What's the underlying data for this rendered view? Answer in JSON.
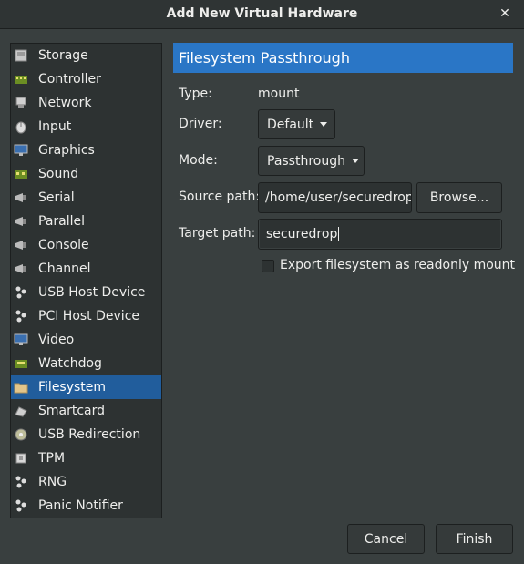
{
  "window": {
    "title": "Add New Virtual Hardware",
    "close_glyph": "✕"
  },
  "sidebar": {
    "items": [
      {
        "label": "Storage",
        "icon": "storage-icon"
      },
      {
        "label": "Controller",
        "icon": "controller-icon"
      },
      {
        "label": "Network",
        "icon": "network-icon"
      },
      {
        "label": "Input",
        "icon": "mouse-icon"
      },
      {
        "label": "Graphics",
        "icon": "monitor-icon"
      },
      {
        "label": "Sound",
        "icon": "sound-card-icon"
      },
      {
        "label": "Serial",
        "icon": "serial-port-icon"
      },
      {
        "label": "Parallel",
        "icon": "parallel-port-icon"
      },
      {
        "label": "Console",
        "icon": "console-port-icon"
      },
      {
        "label": "Channel",
        "icon": "channel-port-icon"
      },
      {
        "label": "USB Host Device",
        "icon": "usb-icon"
      },
      {
        "label": "PCI Host Device",
        "icon": "pci-icon"
      },
      {
        "label": "Video",
        "icon": "video-monitor-icon"
      },
      {
        "label": "Watchdog",
        "icon": "watchdog-icon"
      },
      {
        "label": "Filesystem",
        "icon": "folder-icon"
      },
      {
        "label": "Smartcard",
        "icon": "smartcard-icon"
      },
      {
        "label": "USB Redirection",
        "icon": "usb-redirection-icon"
      },
      {
        "label": "TPM",
        "icon": "tpm-chip-icon"
      },
      {
        "label": "RNG",
        "icon": "rng-icon"
      },
      {
        "label": "Panic Notifier",
        "icon": "panic-notifier-icon"
      }
    ],
    "selected": "Filesystem"
  },
  "panel": {
    "header": "Filesystem Passthrough",
    "type_label": "Type:",
    "type_value": "mount",
    "driver_label": "Driver:",
    "driver_value": "Default",
    "mode_label": "Mode:",
    "mode_value": "Passthrough",
    "source_label": "Source path:",
    "source_value": "/home/user/securedrop",
    "browse_label": "Browse...",
    "target_label": "Target path:",
    "target_value": "securedrop",
    "readonly_label": "Export filesystem as readonly mount",
    "readonly_checked": false
  },
  "footer": {
    "cancel_label": "Cancel",
    "finish_label": "Finish"
  },
  "colors": {
    "background": "#393f3f",
    "selection": "#215d9c",
    "header": "#2a76c6"
  }
}
